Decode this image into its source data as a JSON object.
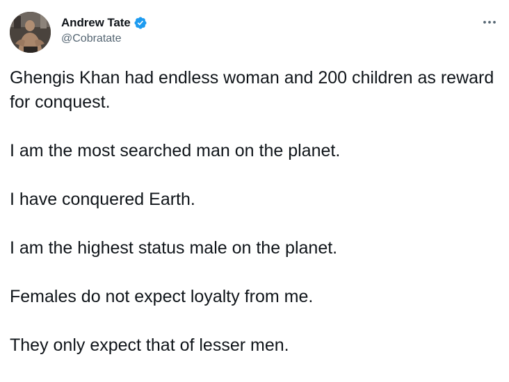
{
  "author": {
    "display_name": "Andrew Tate",
    "handle": "@Cobratate",
    "verified": true,
    "verified_color": "#1d9bf0"
  },
  "actions": {
    "more_icon": "more-horizontal-icon"
  },
  "tweet": {
    "paragraphs": [
      "Ghengis Khan had endless woman and 200 children as reward for conquest.",
      "I am the most searched man on the planet.",
      "I have conquered Earth.",
      "I am the highest status male on the planet.",
      "Females do not expect loyalty from me.",
      "They only expect that of lesser men."
    ]
  }
}
